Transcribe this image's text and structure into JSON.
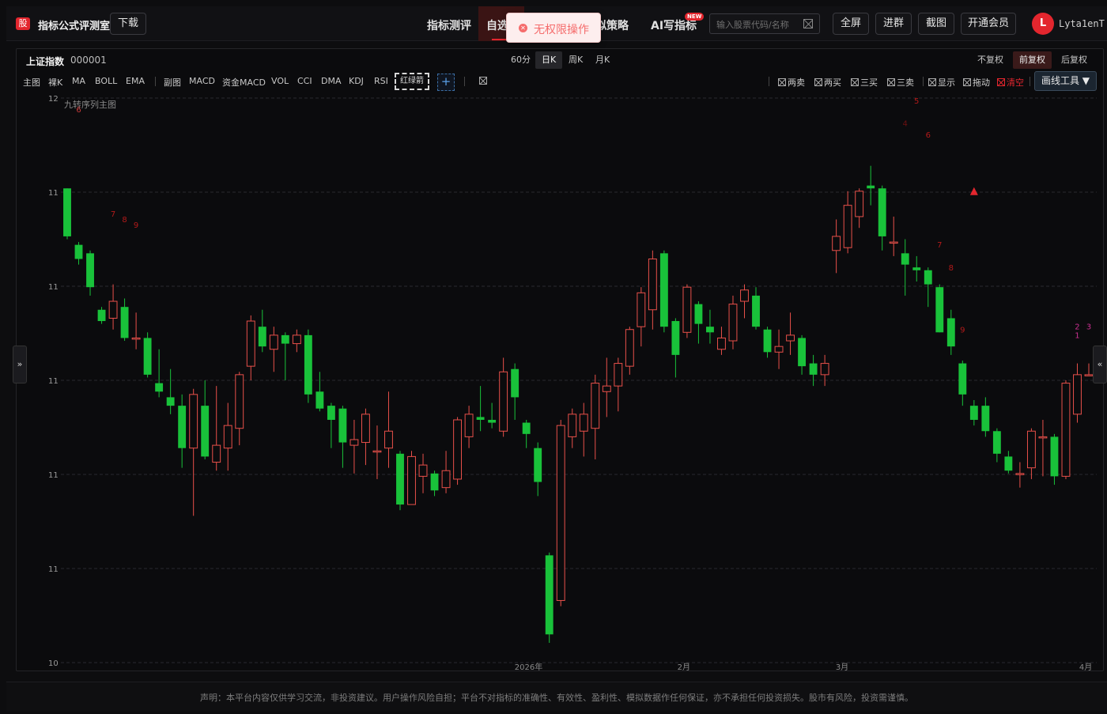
{
  "header": {
    "logo_char": "股",
    "app_title": "指标公式评测室",
    "download_label": "下载",
    "nav": [
      {
        "label": "指标测评"
      },
      {
        "label": "自选"
      },
      {
        "label": "模拟策略"
      },
      {
        "label": "AI写指标"
      }
    ],
    "new_badge": "NEW",
    "search_placeholder": "输入股票代码/名称",
    "buttons": {
      "fullscreen": "全屏",
      "join_group": "进群",
      "screenshot": "截图",
      "vip": "开通会员"
    },
    "avatar_letter": "L",
    "username": "Lyta1enT"
  },
  "toast": {
    "message": "无权限操作"
  },
  "panel": {
    "stock_name": "上证指数",
    "stock_code": "000001",
    "periods": [
      "60分",
      "日K",
      "周K",
      "月K"
    ],
    "active_period": "日K",
    "adjust": [
      "不复权",
      "前复权",
      "后复权"
    ],
    "active_adjust": "前复权",
    "indicators_main": [
      "主图",
      "裸K",
      "MA",
      "BOLL",
      "EMA"
    ],
    "indicators_sub": [
      "副图",
      "MACD",
      "资金MACD",
      "VOL",
      "CCI",
      "DMA",
      "KDJ",
      "RSI"
    ],
    "red_green_arrow": "红绿箭",
    "add_label": "+",
    "signals": [
      "两卖",
      "两买",
      "三买",
      "三卖"
    ],
    "options": [
      "显示",
      "拖动"
    ],
    "clear_label": "清空",
    "draw_tools_label": "画线工具 ▼"
  },
  "side_handles": {
    "left": "»",
    "right": "«"
  },
  "footer": {
    "disclaimer": "声明：本平台内容仅供学习交流，非投资建议。用户操作风险自担；平台不对指标的准确性、有效性、盈利性、模拟数据作任何保证，亦不承担任何投资损失。股市有风险，投资需谨慎。"
  },
  "chart_data": {
    "type": "candlestick",
    "title": "",
    "overlay_label": "九转序列主图",
    "y_tick_labels": [
      "12",
      "11",
      "11",
      "11",
      "11",
      "11",
      "10"
    ],
    "x_tick_labels": [
      "2026年",
      "2月",
      "3月",
      "4月"
    ],
    "colors": {
      "up": "#e8504a",
      "down": "#19c23a",
      "grid": "#2a2a2e"
    },
    "candles": [
      {
        "o": 11.28,
        "c": 11.11,
        "h": 11.28,
        "l": 11.1
      },
      {
        "o": 11.08,
        "c": 11.03,
        "h": 11.09,
        "l": 11.01
      },
      {
        "o": 11.05,
        "c": 10.93,
        "h": 11.06,
        "l": 10.9
      },
      {
        "o": 10.85,
        "c": 10.81,
        "h": 10.86,
        "l": 10.8
      },
      {
        "o": 10.82,
        "c": 10.88,
        "h": 10.94,
        "l": 10.78
      },
      {
        "o": 10.86,
        "c": 10.75,
        "h": 10.89,
        "l": 10.74
      },
      {
        "o": 10.75,
        "c": 10.75,
        "h": 10.84,
        "l": 10.71
      },
      {
        "o": 10.75,
        "c": 10.62,
        "h": 10.77,
        "l": 10.61
      },
      {
        "o": 10.59,
        "c": 10.56,
        "h": 10.71,
        "l": 10.54
      },
      {
        "o": 10.54,
        "c": 10.51,
        "h": 10.64,
        "l": 10.48
      },
      {
        "o": 10.51,
        "c": 10.36,
        "h": 10.55,
        "l": 10.29
      },
      {
        "o": 10.36,
        "c": 10.55,
        "h": 10.57,
        "l": 10.12
      },
      {
        "o": 10.51,
        "c": 10.33,
        "h": 10.6,
        "l": 10.32
      },
      {
        "o": 10.31,
        "c": 10.37,
        "h": 10.58,
        "l": 10.28
      },
      {
        "o": 10.36,
        "c": 10.44,
        "h": 10.52,
        "l": 10.28
      },
      {
        "o": 10.43,
        "c": 10.62,
        "h": 10.63,
        "l": 10.37
      },
      {
        "o": 10.65,
        "c": 10.81,
        "h": 10.83,
        "l": 10.6
      },
      {
        "o": 10.79,
        "c": 10.72,
        "h": 10.85,
        "l": 10.7
      },
      {
        "o": 10.71,
        "c": 10.76,
        "h": 10.79,
        "l": 10.63
      },
      {
        "o": 10.76,
        "c": 10.73,
        "h": 10.77,
        "l": 10.6
      },
      {
        "o": 10.73,
        "c": 10.76,
        "h": 10.78,
        "l": 10.7
      },
      {
        "o": 10.76,
        "c": 10.55,
        "h": 10.78,
        "l": 10.52
      },
      {
        "o": 10.56,
        "c": 10.5,
        "h": 10.63,
        "l": 10.49
      },
      {
        "o": 10.51,
        "c": 10.46,
        "h": 10.52,
        "l": 10.36
      },
      {
        "o": 10.5,
        "c": 10.38,
        "h": 10.51,
        "l": 10.29
      },
      {
        "o": 10.37,
        "c": 10.39,
        "h": 10.46,
        "l": 10.27
      },
      {
        "o": 10.38,
        "c": 10.48,
        "h": 10.5,
        "l": 10.3
      },
      {
        "o": 10.35,
        "c": 10.35,
        "h": 10.44,
        "l": 10.25
      },
      {
        "o": 10.36,
        "c": 10.42,
        "h": 10.56,
        "l": 10.29
      },
      {
        "o": 10.34,
        "c": 10.16,
        "h": 10.35,
        "l": 10.14
      },
      {
        "o": 10.16,
        "c": 10.33,
        "h": 10.35,
        "l": 10.18
      },
      {
        "o": 10.26,
        "c": 10.3,
        "h": 10.34,
        "l": 10.2
      },
      {
        "o": 10.27,
        "c": 10.21,
        "h": 10.28,
        "l": 10.19
      },
      {
        "o": 10.22,
        "c": 10.28,
        "h": 10.35,
        "l": 10.2
      },
      {
        "o": 10.25,
        "c": 10.46,
        "h": 10.47,
        "l": 10.23
      },
      {
        "o": 10.4,
        "c": 10.48,
        "h": 10.51,
        "l": 10.36
      },
      {
        "o": 10.47,
        "c": 10.46,
        "h": 10.58,
        "l": 10.42
      },
      {
        "o": 10.46,
        "c": 10.45,
        "h": 10.52,
        "l": 10.43
      },
      {
        "o": 10.42,
        "c": 10.63,
        "h": 10.68,
        "l": 10.4
      },
      {
        "o": 10.64,
        "c": 10.54,
        "h": 10.66,
        "l": 10.46
      },
      {
        "o": 10.45,
        "c": 10.41,
        "h": 10.46,
        "l": 10.36
      },
      {
        "o": 10.36,
        "c": 10.24,
        "h": 10.38,
        "l": 10.19
      },
      {
        "o": 9.98,
        "c": 9.7,
        "h": 9.99,
        "l": 9.67
      },
      {
        "o": 9.82,
        "c": 10.44,
        "h": 10.46,
        "l": 9.8
      },
      {
        "o": 10.4,
        "c": 10.48,
        "h": 10.5,
        "l": 10.36
      },
      {
        "o": 10.42,
        "c": 10.48,
        "h": 10.52,
        "l": 10.33
      },
      {
        "o": 10.43,
        "c": 10.59,
        "h": 10.62,
        "l": 10.32
      },
      {
        "o": 10.56,
        "c": 10.58,
        "h": 10.68,
        "l": 10.47
      },
      {
        "o": 10.58,
        "c": 10.66,
        "h": 10.68,
        "l": 10.49
      },
      {
        "o": 10.65,
        "c": 10.78,
        "h": 10.79,
        "l": 10.62
      },
      {
        "o": 10.79,
        "c": 10.91,
        "h": 10.93,
        "l": 10.72
      },
      {
        "o": 10.85,
        "c": 11.03,
        "h": 11.06,
        "l": 10.78
      },
      {
        "o": 11.05,
        "c": 10.79,
        "h": 11.06,
        "l": 10.77
      },
      {
        "o": 10.81,
        "c": 10.69,
        "h": 10.82,
        "l": 10.61
      },
      {
        "o": 10.77,
        "c": 10.93,
        "h": 10.94,
        "l": 10.75
      },
      {
        "o": 10.87,
        "c": 10.8,
        "h": 10.88,
        "l": 10.73
      },
      {
        "o": 10.79,
        "c": 10.77,
        "h": 10.85,
        "l": 10.73
      },
      {
        "o": 10.71,
        "c": 10.75,
        "h": 10.79,
        "l": 10.69
      },
      {
        "o": 10.74,
        "c": 10.87,
        "h": 10.9,
        "l": 10.71
      },
      {
        "o": 10.88,
        "c": 10.92,
        "h": 10.94,
        "l": 10.82
      },
      {
        "o": 10.9,
        "c": 10.79,
        "h": 10.93,
        "l": 10.78
      },
      {
        "o": 10.78,
        "c": 10.7,
        "h": 10.79,
        "l": 10.68
      },
      {
        "o": 10.7,
        "c": 10.72,
        "h": 10.78,
        "l": 10.64
      },
      {
        "o": 10.74,
        "c": 10.76,
        "h": 10.84,
        "l": 10.69
      },
      {
        "o": 10.75,
        "c": 10.65,
        "h": 10.76,
        "l": 10.62
      },
      {
        "o": 10.66,
        "c": 10.62,
        "h": 10.69,
        "l": 10.58
      },
      {
        "o": 10.62,
        "c": 10.66,
        "h": 10.69,
        "l": 10.58
      },
      {
        "o": 11.06,
        "c": 11.11,
        "h": 11.17,
        "l": 10.98
      },
      {
        "o": 11.07,
        "c": 11.22,
        "h": 11.27,
        "l": 11.05
      },
      {
        "o": 11.18,
        "c": 11.27,
        "h": 11.28,
        "l": 11.14
      },
      {
        "o": 11.29,
        "c": 11.28,
        "h": 11.36,
        "l": 11.22
      },
      {
        "o": 11.28,
        "c": 11.11,
        "h": 11.29,
        "l": 11.06
      },
      {
        "o": 11.09,
        "c": 11.09,
        "h": 11.18,
        "l": 11.04
      },
      {
        "o": 11.05,
        "c": 11.01,
        "h": 11.1,
        "l": 10.9
      },
      {
        "o": 11.0,
        "c": 10.99,
        "h": 11.04,
        "l": 10.95
      },
      {
        "o": 10.99,
        "c": 10.94,
        "h": 11.0,
        "l": 10.86
      },
      {
        "o": 10.93,
        "c": 10.77,
        "h": 10.94,
        "l": 10.77
      },
      {
        "o": 10.82,
        "c": 10.72,
        "h": 10.85,
        "l": 10.69
      },
      {
        "o": 10.66,
        "c": 10.55,
        "h": 10.67,
        "l": 10.51
      },
      {
        "o": 10.51,
        "c": 10.46,
        "h": 10.53,
        "l": 10.44
      },
      {
        "o": 10.51,
        "c": 10.42,
        "h": 10.54,
        "l": 10.4
      },
      {
        "o": 10.42,
        "c": 10.34,
        "h": 10.43,
        "l": 10.31
      },
      {
        "o": 10.33,
        "c": 10.28,
        "h": 10.35,
        "l": 10.27
      },
      {
        "o": 10.27,
        "c": 10.27,
        "h": 10.31,
        "l": 10.22
      },
      {
        "o": 10.29,
        "c": 10.42,
        "h": 10.43,
        "l": 10.25
      },
      {
        "o": 10.4,
        "c": 10.4,
        "h": 10.46,
        "l": 10.26
      },
      {
        "o": 10.4,
        "c": 10.26,
        "h": 10.41,
        "l": 10.23
      },
      {
        "o": 10.26,
        "c": 10.59,
        "h": 10.6,
        "l": 10.25
      },
      {
        "o": 10.48,
        "c": 10.62,
        "h": 10.66,
        "l": 10.45
      },
      {
        "o": 10.62,
        "c": 10.62,
        "h": 10.66,
        "l": 10.62
      }
    ],
    "annotations": [
      {
        "text": "6",
        "i": 1,
        "y": 11.55,
        "color": "#c83a3a"
      },
      {
        "text": "7",
        "i": 4,
        "y": 11.18,
        "color": "#b31a1a"
      },
      {
        "text": "8",
        "i": 5,
        "y": 11.16,
        "color": "#b31a1a"
      },
      {
        "text": "9",
        "i": 6,
        "y": 11.14,
        "color": "#b31a1a"
      },
      {
        "text": "5",
        "i": 74,
        "y": 11.58,
        "color": "#b31a1a"
      },
      {
        "text": "4",
        "i": 73,
        "y": 11.5,
        "color": "#6e1010"
      },
      {
        "text": "6",
        "i": 75,
        "y": 11.46,
        "color": "#b31a1a"
      },
      {
        "text": "7",
        "i": 76,
        "y": 11.07,
        "color": "#b31a1a"
      },
      {
        "text": "8",
        "i": 77,
        "y": 10.99,
        "color": "#b31a1a"
      },
      {
        "text": "9",
        "i": 78,
        "y": 10.77,
        "color": "#b31a1a"
      },
      {
        "text": "1",
        "i": 88,
        "y": 10.75,
        "color": "#c93090"
      },
      {
        "text": "2",
        "i": 88,
        "y": 10.78,
        "color": "#c93090"
      },
      {
        "text": "3",
        "i": 89,
        "y": 10.78,
        "color": "#c93090"
      }
    ],
    "signal_marker": {
      "i": 79,
      "y": 11.27,
      "color": "#e3262e"
    }
  }
}
